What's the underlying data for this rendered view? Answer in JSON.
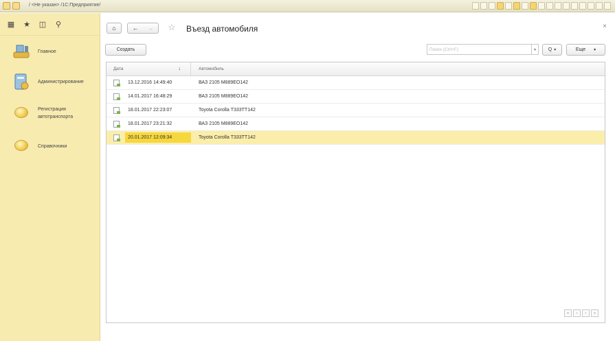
{
  "window": {
    "title": "/ <Не указан> /1С:Предприятие/"
  },
  "sidebar": {
    "top_icons": [
      "apps-grid-icon",
      "star-icon",
      "history-icon",
      "search-icon"
    ],
    "items": [
      {
        "label": "Главное",
        "icon": "home-desk-icon"
      },
      {
        "label": "Администрирование",
        "icon": "admin-server-icon"
      },
      {
        "label": "Регистрация автотранспорта",
        "icon": "yellow-ball-icon"
      },
      {
        "label": "Справочники",
        "icon": "yellow-ball-icon"
      }
    ]
  },
  "form": {
    "title": "Въезд автомобиля",
    "create_label": "Создать",
    "search_placeholder": "Поиск (Ctrl+F)",
    "find_label": "Q",
    "more_label": "Еще"
  },
  "table": {
    "columns": [
      "Дата",
      "Автомобиль"
    ],
    "sort_indicator": "↓",
    "rows": [
      {
        "date": "13.12.2016 14:49:40",
        "car": "ВАЗ 2105 М889ЕО142",
        "selected": false
      },
      {
        "date": "14.01.2017 16:48:29",
        "car": "ВАЗ 2105 М889ЕО142",
        "selected": false
      },
      {
        "date": "18.01.2017 22:23:07",
        "car": "Toyota Corolla Т333ТТ142",
        "selected": false
      },
      {
        "date": "18.01.2017 23:21:32",
        "car": "ВАЗ 2105 М889ЕО142",
        "selected": false
      },
      {
        "date": "20.01.2017 12:09:34",
        "car": "Toyota Corolla Т333ТТ142",
        "selected": true
      }
    ]
  },
  "colors": {
    "sidebar_bg": "#f8ebb0",
    "selected_row": "#fbeeaa",
    "selected_cell": "#f7d73e"
  }
}
